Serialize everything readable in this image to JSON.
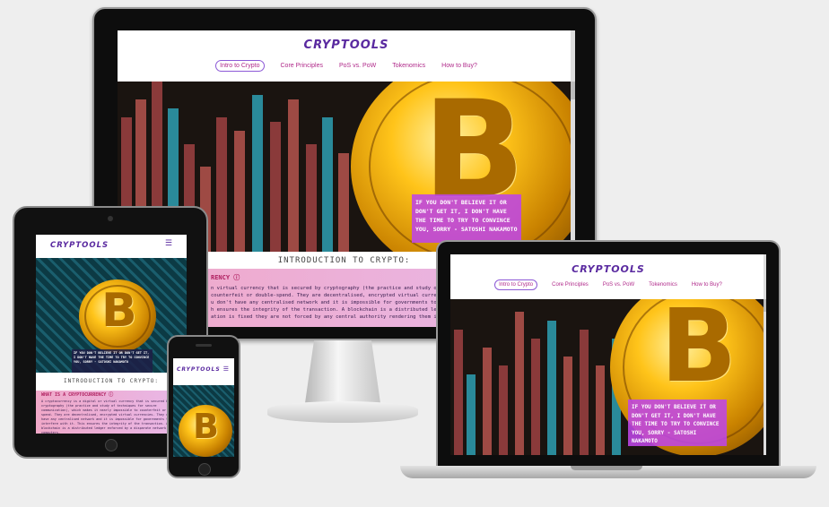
{
  "site": {
    "logo": "CRYPTOOLS",
    "nav": [
      "Intro to Crypto",
      "Core Principles",
      "PoS vs. PoW",
      "Tokenomics",
      "How to Buy?"
    ],
    "hamburger": "☰",
    "quote": "IF YOU DON'T BELIEVE IT OR DON'T GET IT, I DON'T HAVE THE TIME TO TRY TO CONVINCE YOU, SORRY - SATOSHI NAKAMOTO",
    "section_title": "INTRODUCTION TO CRYPTO:",
    "what_heading": "WHAT IS A CRYPTOCURRENCY ⓘ",
    "what_heading_partial": "RENCY ⓘ",
    "what_body": "A cryptocurrency is a digital or virtual currency that is secured by cryptography (the practice and study of techniques for secure communication), which makes it nearly impossible to counterfeit or double-spend. They are decentralised, encrypted virtual currencies. They don't have any centralised network and it is impossible for governments to interfere with it. This ensures the integrity of the transaction. A blockchain is a distributed ledger enforced by a disparate network of computers.",
    "desktop_body_lines": [
      "n virtual currency that is secured by cryptography (the practice and study of",
      "counterfeit or double-spend. They are decentralised, encrypted virtual currencies",
      "u don't have any centralised network and it is impossible for governments to int",
      "h ensures the integrity of the transaction. A blockchain is a distributed ledger",
      "ation is fixed they are not forced by any central authority rendering them immune"
    ]
  },
  "colors": {
    "logo": "#5a2aa0",
    "nav_text": "#b02a8a",
    "quote_bg": "#be46e6",
    "accent_pink": "#e85a9a"
  }
}
